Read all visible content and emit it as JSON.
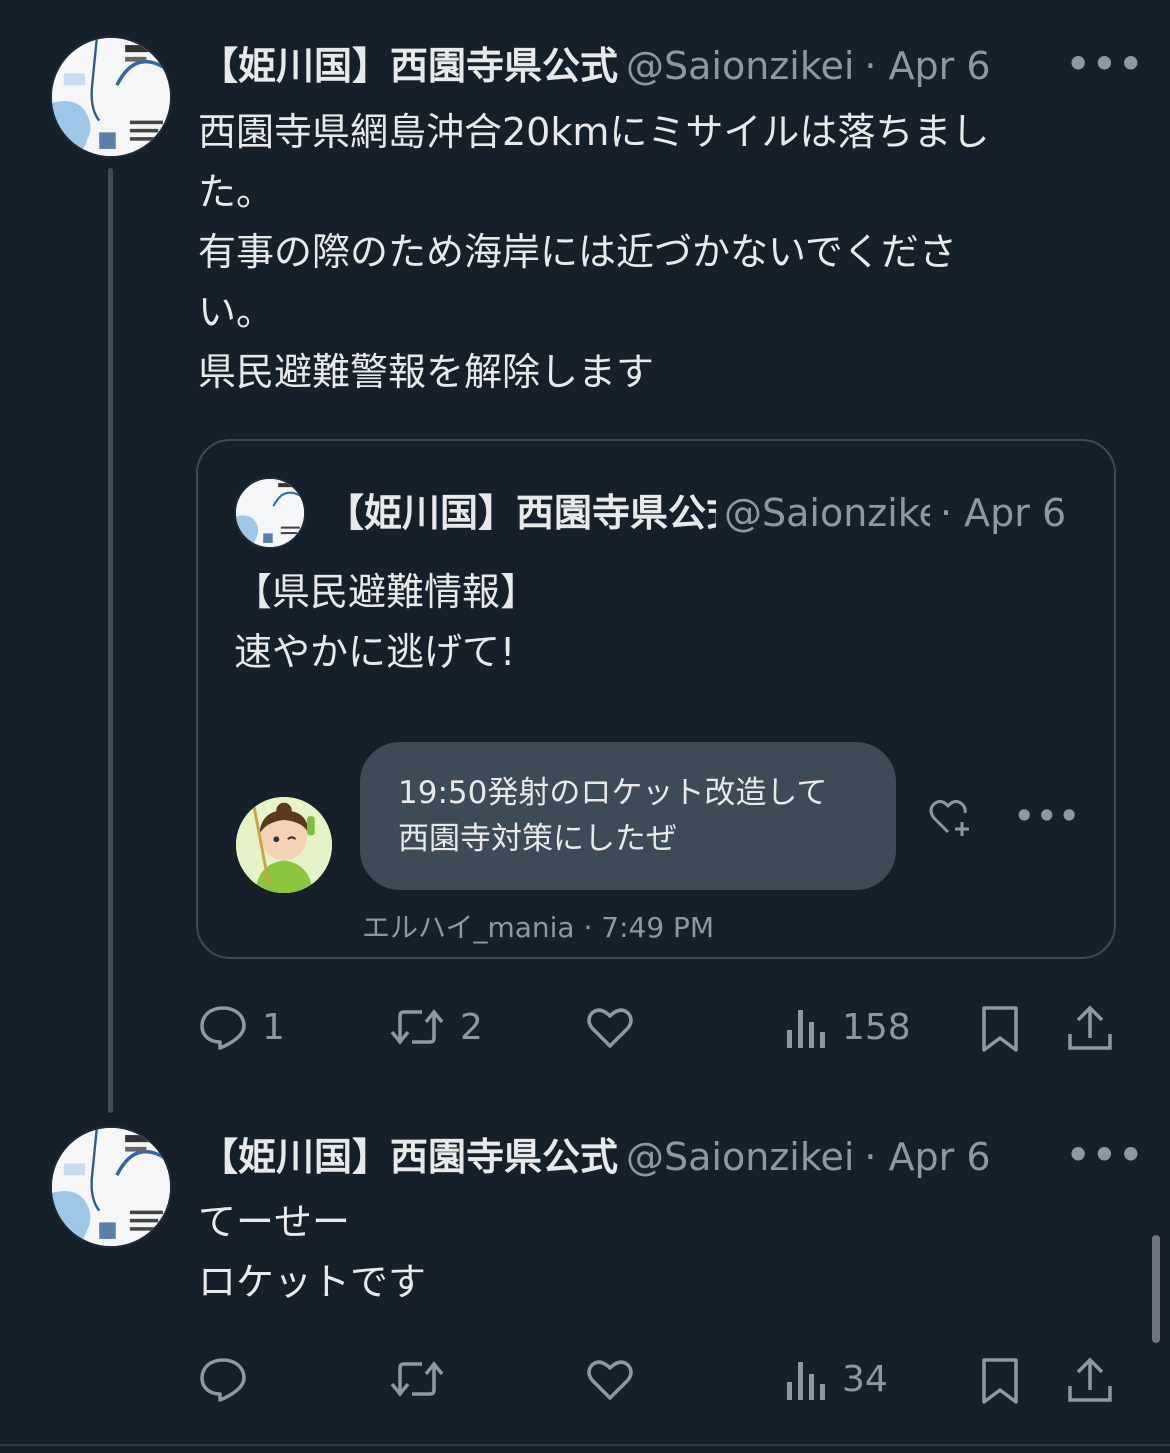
{
  "tweets": [
    {
      "name": "【姫川国】西園寺県公式",
      "handle": "@Saionzikei",
      "date": "· Apr 6",
      "more": "•••",
      "lines": [
        "西園寺県網島沖合20kmにミサイルは落ちまし",
        "た。",
        "有事の際のため海岸には近づかないでくださ",
        "い。",
        "県民避難警報を解除します"
      ],
      "actions": {
        "reply": "1",
        "retweet": "2",
        "like": "",
        "views": "158"
      }
    },
    {
      "name": "【姫川国】西園寺県公式",
      "handle": "@Saionzikei",
      "date": "· Apr 6",
      "more": "•••",
      "lines": [
        "てーせー",
        "ロケットです"
      ],
      "actions": {
        "reply": "",
        "retweet": "",
        "like": "",
        "views": "34"
      }
    }
  ],
  "quote": {
    "name": "【姫川国】西園寺県公式",
    "handle": "@Saionzikei",
    "date": "· Apr 6",
    "lines": [
      "【県民避難情報】",
      "速やかに逃げて!"
    ],
    "embedded_reply": {
      "lines": [
        "19:50発射のロケット改造して",
        "西園寺対策にしたぜ"
      ],
      "meta": "エルハイ_mania · 7:49 PM",
      "more": "•••"
    }
  },
  "icons": {
    "reply": "speech-bubble-icon",
    "retweet": "retweet-arrows-icon",
    "like": "heart-icon",
    "views": "bar-chart-icon",
    "bookmark": "bookmark-icon",
    "share": "share-upload-icon",
    "react": "heart-plus-icon"
  },
  "colors": {
    "background": "#15202b",
    "text": "#e7e9ea",
    "muted": "#8b98a5",
    "border": "#3d4a57"
  }
}
